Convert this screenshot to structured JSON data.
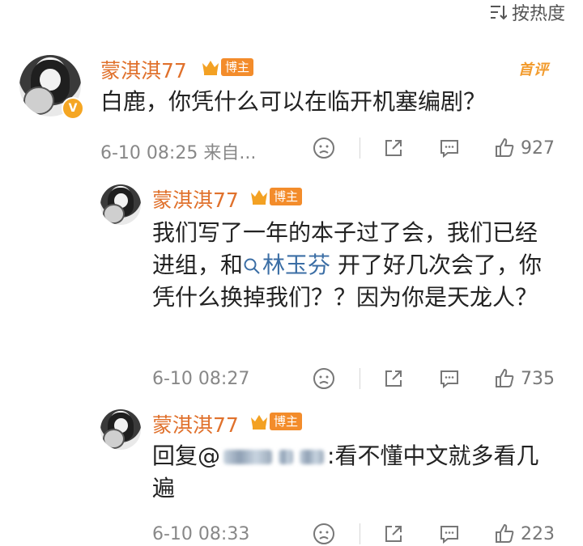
{
  "sort": {
    "label": "按热度",
    "icon": "sort-icon"
  },
  "comments": [
    {
      "name": "蒙淇淇77",
      "tag": "博主",
      "first_badge": "首评",
      "text": "白鹿，你凭什么可以在临开机塞编剧？",
      "time": "6-10 08:25",
      "source": "来自...",
      "likes": "927"
    },
    {
      "name": "蒙淇淇77",
      "tag": "博主",
      "text_parts": [
        "我们写了一年的本子过了会，我们已经进组，和",
        "林玉芬",
        "开了好几次会了，你凭什么换掉我们？？因为你是天龙人？"
      ],
      "mention": "林玉芬",
      "time": "6-10 08:27",
      "likes": "735"
    },
    {
      "name": "蒙淇淇77",
      "tag": "博主",
      "reply_prefix": "回复@",
      "reply_suffix": ":看不懂中文就多看几遍",
      "time": "6-10 08:33",
      "likes": "223"
    }
  ],
  "accent_colors": {
    "name": "#e0712c",
    "tag": "#f38c2b",
    "mention": "#3b6ea5"
  }
}
